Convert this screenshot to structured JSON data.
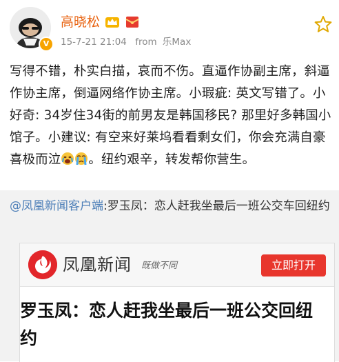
{
  "post": {
    "author": "高晓松",
    "timestamp": "15-7-21 21:04",
    "source_prefix": "from",
    "source_device": "乐Max",
    "body_main": "写得不错，朴实白描，哀而不伤。直逼作协副主席，斜逼作协主席，倒逼网络作协主席。小瑕疵: 英文写错了。小好奇: 34岁住34街的前男友是韩国移民? 那里好多韩国小馆子。小建议: 有空来好莱坞看看剩女们，你会充满自豪喜极而泣",
    "body_tail": "。纽约艰辛，转发帮你营生。",
    "emojis": [
      "crying-emoji",
      "tears-emoji"
    ]
  },
  "repost": {
    "user": "@凤凰新闻客户端",
    "text": ":罗玉凤：恋人赶我坐最后一班公交车回纽约"
  },
  "card": {
    "app_name": "凤凰新闻",
    "slogan": "既做不同",
    "open_button": "立即打开",
    "headline": "罗玉凤：恋人赶我坐最后一班公交回纽约"
  },
  "colors": {
    "username": "#e8620f",
    "link": "#4d7fb8",
    "brand_red": "#e2262a",
    "button_red": "#e8362d"
  },
  "icons": [
    "avatar",
    "vip-badge",
    "crown-badge",
    "red-envelope-badge",
    "star-icon",
    "ifeng-logo"
  ]
}
